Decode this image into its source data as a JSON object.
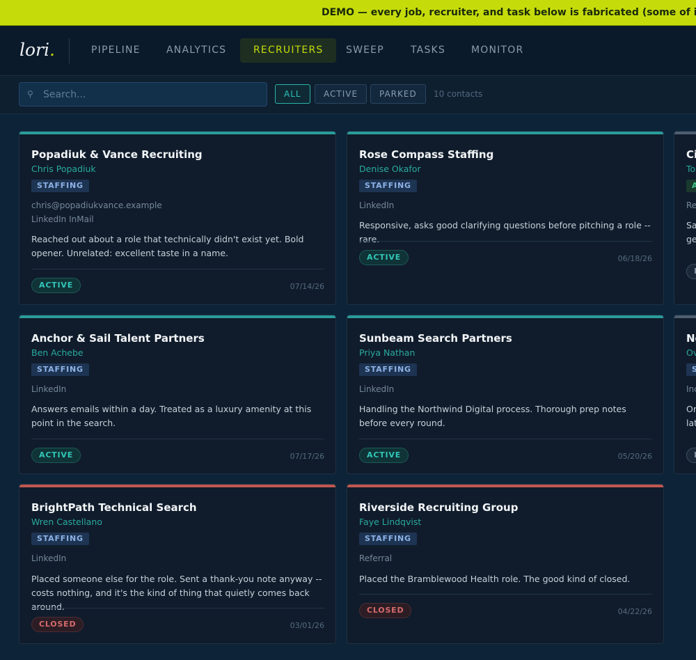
{
  "banner": {
    "text": "DEMO — every job, recruiter, and task below is fabricated (some of it on purp"
  },
  "app": {
    "logo": "lori",
    "logo_dot": "."
  },
  "nav": {
    "items": [
      {
        "label": "PIPELINE"
      },
      {
        "label": "ANALYTICS"
      },
      {
        "label": "RECRUITERS"
      },
      {
        "label": "SWEEP"
      },
      {
        "label": "TASKS"
      },
      {
        "label": "MONITOR"
      }
    ],
    "active": "RECRUITERS"
  },
  "toolbar": {
    "search_placeholder": "Search...",
    "search_icon": "search-icon",
    "filters": [
      {
        "label": "ALL"
      },
      {
        "label": "ACTIVE"
      },
      {
        "label": "PARKED"
      }
    ],
    "active_filter": "ALL",
    "count": "10 contacts"
  },
  "colors": {
    "accent": "#c6dc0a",
    "active_bar": "#2a9d99",
    "closed_bar": "#c0574f",
    "partial_bar": "#4e5f72"
  },
  "cards": [
    {
      "title": "Popadiuk & Vance Recruiting",
      "person": "Chris Popadiuk",
      "tag": "STAFFING",
      "email": "chris@popadiukvance.example",
      "source": "LinkedIn InMail",
      "note": "Reached out about a role that technically didn't exist yet. Bold opener. Unrelated: excellent taste in a name.",
      "status": "ACTIVE",
      "date": "07/14/26"
    },
    {
      "title": "Rose Compass Staffing",
      "person": "Denise Okafor",
      "tag": "STAFFING",
      "source": "LinkedIn",
      "note": "Responsive, asks good clarifying questions before pitching a role -- rare.",
      "status": "ACTIVE",
      "date": "06/18/26"
    },
    {
      "title": "Ci",
      "person": "To",
      "tag": "A",
      "source": "Re",
      "note": "Sa\nge",
      "status": "P",
      "date": ""
    },
    {
      "title": "Anchor & Sail Talent Partners",
      "person": "Ben Achebe",
      "tag": "STAFFING",
      "source": "LinkedIn",
      "note": "Answers emails within a day. Treated as a luxury amenity at this point in the search.",
      "status": "ACTIVE",
      "date": "07/17/26"
    },
    {
      "title": "Sunbeam Search Partners",
      "person": "Priya Nathan",
      "tag": "STAFFING",
      "source": "LinkedIn",
      "note": "Handling the Northwind Digital process. Thorough prep notes before every round.",
      "status": "ACTIVE",
      "date": "05/20/26"
    },
    {
      "title": "Ne",
      "person": "Ov",
      "tag": "S",
      "source": "Inc",
      "note": "Or\nlat",
      "status": "P",
      "date": ""
    },
    {
      "title": "BrightPath Technical Search",
      "person": "Wren Castellano",
      "tag": "STAFFING",
      "source": "LinkedIn",
      "note": "Placed someone else for the role. Sent a thank-you note anyway -- costs nothing, and it's the kind of thing that quietly comes back around.",
      "status": "CLOSED",
      "date": "03/01/26"
    },
    {
      "title": "Riverside Recruiting Group",
      "person": "Faye Lindqvist",
      "tag": "STAFFING",
      "source": "Referral",
      "note": "Placed the Bramblewood Health role. The good kind of closed.",
      "status": "CLOSED",
      "date": "04/22/26"
    }
  ]
}
